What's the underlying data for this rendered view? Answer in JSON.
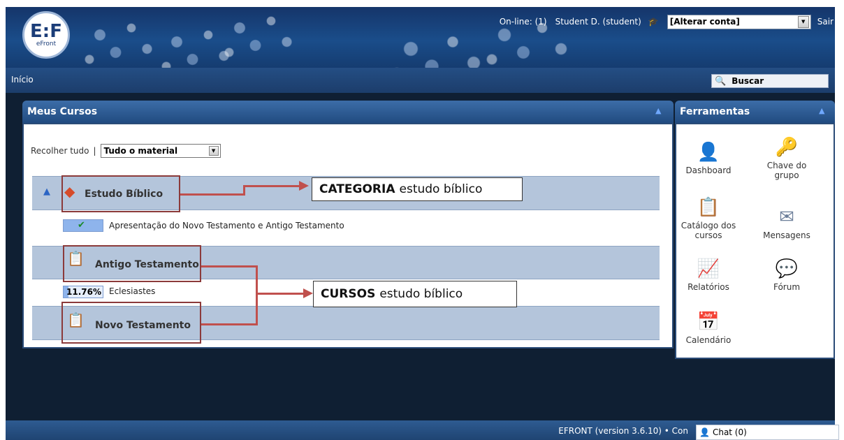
{
  "app": {
    "logo_mark": "E:F",
    "logo_text": "eFront"
  },
  "topbar": {
    "online": "On-line: (1)",
    "user": "Student D. (student)",
    "account_select": "[Alterar conta]",
    "logout": "Sair"
  },
  "nav": {
    "home": "Início",
    "search_label": "Buscar"
  },
  "courses_panel": {
    "title": "Meus Cursos",
    "collapse_all": "Recolher tudo",
    "separator": "|",
    "filter_value": "Tudo o material",
    "categories": [
      {
        "name": "Estudo Bíblico"
      },
      {
        "name": "Antigo Testamento"
      },
      {
        "name": "Novo Testamento"
      }
    ],
    "courses": [
      {
        "name": "Apresentação do Novo Testamento e Antigo Testamento",
        "status": "completed",
        "progress": 100
      },
      {
        "name": "Eclesiastes",
        "progress_label": "11.76%",
        "progress": 11.76
      }
    ]
  },
  "annotations": {
    "category": {
      "bold": "CATEGORIA",
      "text": "estudo bíblico"
    },
    "courses": {
      "bold": "CURSOS",
      "text": "estudo bíblico"
    }
  },
  "tools_panel": {
    "title": "Ferramentas",
    "items": [
      {
        "label": "Dashboard",
        "icon": "user-icon"
      },
      {
        "label": "Chave do grupo",
        "icon": "key-icon"
      },
      {
        "label": "Catálogo dos cursos",
        "icon": "chalkboard-icon"
      },
      {
        "label": "Mensagens",
        "icon": "envelope-icon"
      },
      {
        "label": "Relatórios",
        "icon": "chart-icon"
      },
      {
        "label": "Fórum",
        "icon": "chat-bubbles-icon"
      },
      {
        "label": "Calendário",
        "icon": "calendar-icon"
      }
    ]
  },
  "footer": {
    "text": "EFRONT (version 3.6.10) • Con"
  },
  "chat": {
    "label": "Chat (0)"
  },
  "colors": {
    "header": "#1a4d8a",
    "panel_head": "#3c6da8",
    "band": "#b4c5db",
    "highlight_box": "#8b3a3a",
    "arrow": "#c0504d"
  }
}
